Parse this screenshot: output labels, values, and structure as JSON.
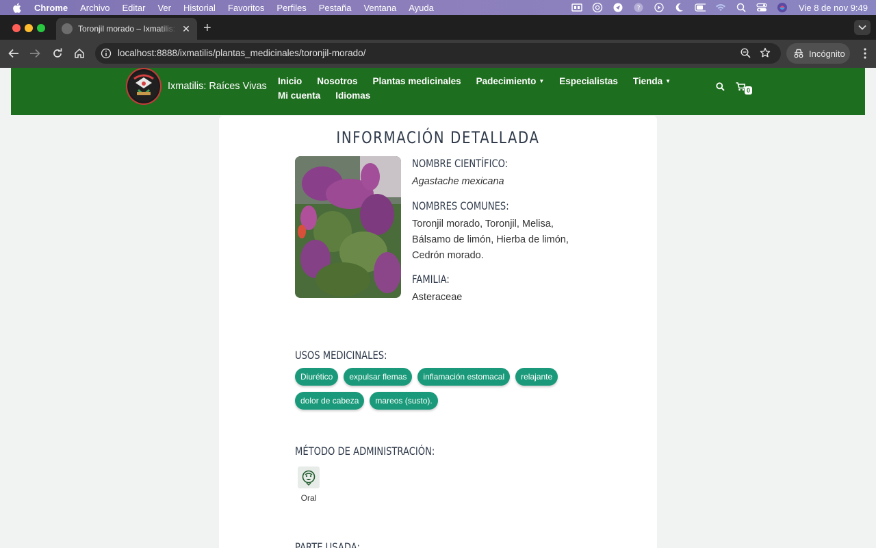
{
  "menubar": {
    "app_name": "Chrome",
    "items": [
      "Archivo",
      "Editar",
      "Ver",
      "Historial",
      "Favoritos",
      "Perfiles",
      "Pestaña",
      "Ventana",
      "Ayuda"
    ],
    "clock": "Vie 8 de nov  9:49"
  },
  "browser": {
    "tab_title": "Toronjil morado – Ixmatilis: Raíces Vivas",
    "url": "localhost:8888/ixmatilis/plantas_medicinales/toronjil-morado/",
    "incognito_label": "Incógnito"
  },
  "site": {
    "title": "Ixmatilis: Raíces Vivas",
    "nav": [
      "Inicio",
      "Nosotros",
      "Plantas medicinales",
      "Padecimiento",
      "Especialistas",
      "Tienda",
      "Mi cuenta",
      "Idiomas"
    ],
    "cart_count": "0",
    "colors": {
      "header": "#1e6e1f",
      "tag": "#1a9a7a"
    }
  },
  "plant": {
    "heading": "INFORMACIÓN DETALLADA",
    "scientific_label": "NOMBRE CIENTÍFICO:",
    "scientific_name": "Agastache mexicana",
    "common_label": "NOMBRES COMUNES:",
    "common_line1": "Toronjil morado, Toronjil, Melisa,",
    "common_line2": "Bálsamo de limón, Hierba de limón,",
    "common_line3": "Cedrón morado.",
    "family_label": "FAMILIA:",
    "family": "Asteraceae",
    "uses_label": "USOS MEDICINALES:",
    "uses": [
      "Diurético",
      "expulsar flemas",
      "inflamación estomacal",
      "relajante",
      "dolor de cabeza",
      "mareos (susto)."
    ],
    "method_label": "MÉTODO DE ADMINISTRACIÓN:",
    "method": "Oral",
    "part_label": "PARTE USADA:"
  }
}
